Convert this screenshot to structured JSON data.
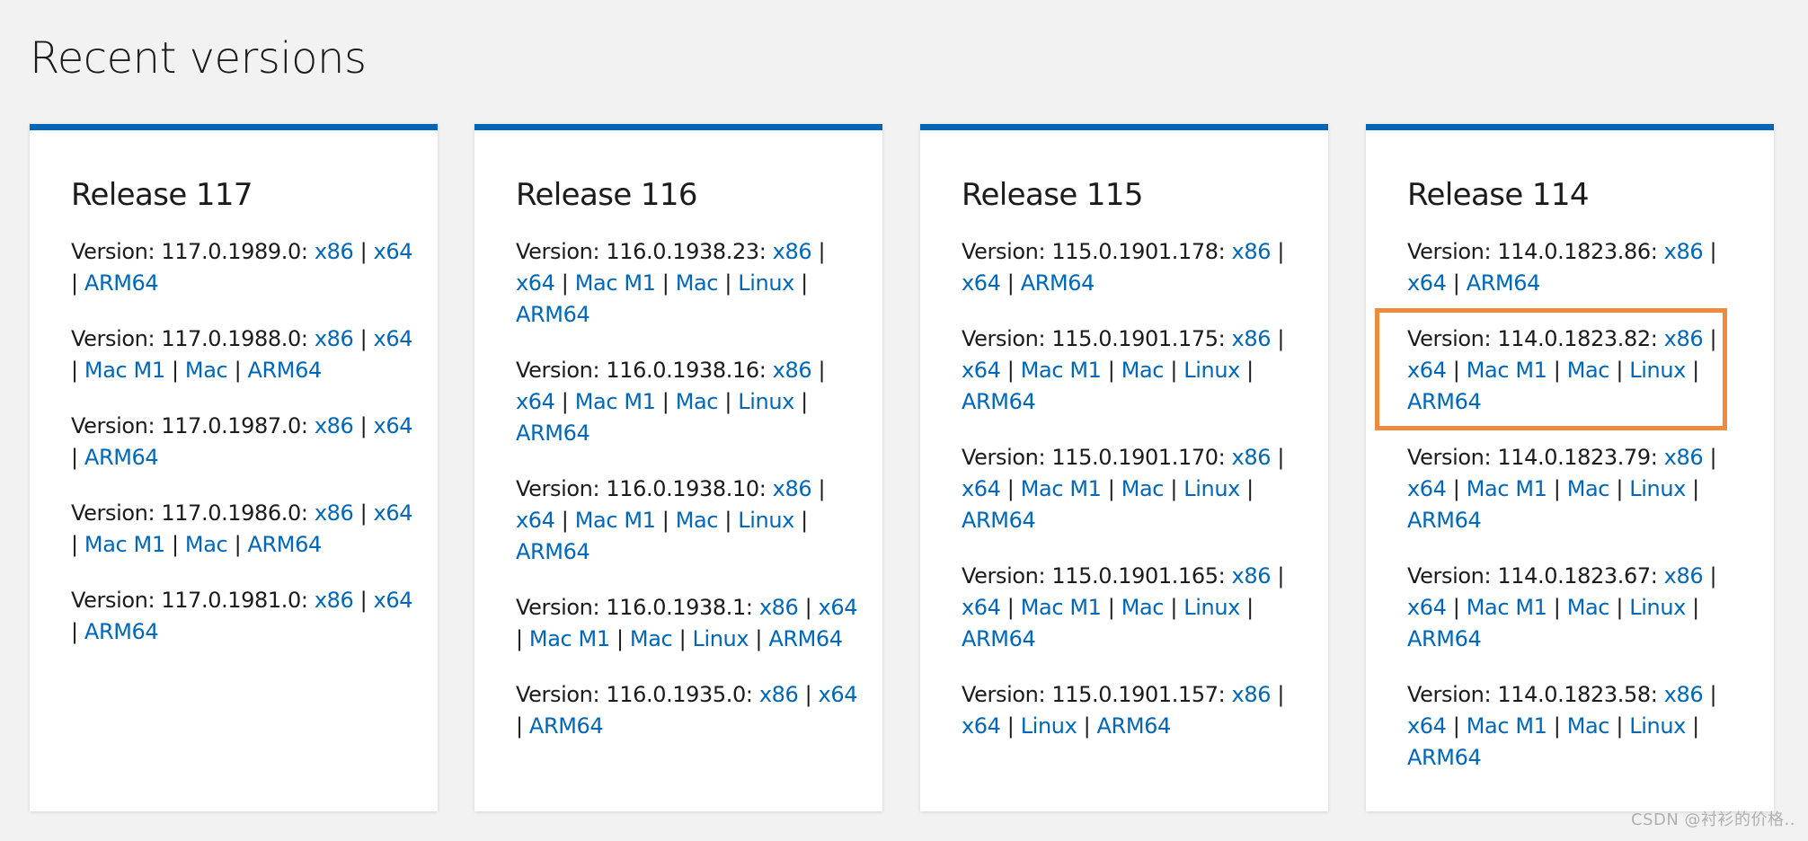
{
  "page": {
    "title": "Recent versions",
    "watermark": "CSDN @衬衫的价格.."
  },
  "colors": {
    "accent": "#0067b8",
    "highlight": "#f08a3c",
    "background": "#f2f2f2"
  },
  "releases": [
    {
      "title": "Release 117",
      "versions": [
        {
          "label": "Version: 117.0.1989.0:",
          "links": [
            "x86",
            "x64",
            "ARM64"
          ]
        },
        {
          "label": "Version: 117.0.1988.0:",
          "links": [
            "x86",
            "x64",
            "Mac M1",
            "Mac",
            "ARM64"
          ]
        },
        {
          "label": "Version: 117.0.1987.0:",
          "links": [
            "x86",
            "x64",
            "ARM64"
          ]
        },
        {
          "label": "Version: 117.0.1986.0:",
          "links": [
            "x86",
            "x64",
            "Mac M1",
            "Mac",
            "ARM64"
          ]
        },
        {
          "label": "Version: 117.0.1981.0:",
          "links": [
            "x86",
            "x64",
            "ARM64"
          ]
        }
      ]
    },
    {
      "title": "Release 116",
      "versions": [
        {
          "label": "Version: 116.0.1938.23:",
          "links": [
            "x86",
            "x64",
            "Mac M1",
            "Mac",
            "Linux",
            "ARM64"
          ]
        },
        {
          "label": "Version: 116.0.1938.16:",
          "links": [
            "x86",
            "x64",
            "Mac M1",
            "Mac",
            "Linux",
            "ARM64"
          ]
        },
        {
          "label": "Version: 116.0.1938.10:",
          "links": [
            "x86",
            "x64",
            "Mac M1",
            "Mac",
            "Linux",
            "ARM64"
          ]
        },
        {
          "label": "Version: 116.0.1938.1:",
          "links": [
            "x86",
            "x64",
            "Mac M1",
            "Mac",
            "Linux",
            "ARM64"
          ]
        },
        {
          "label": "Version: 116.0.1935.0:",
          "links": [
            "x86",
            "x64",
            "ARM64"
          ]
        }
      ]
    },
    {
      "title": "Release 115",
      "versions": [
        {
          "label": "Version: 115.0.1901.178:",
          "links": [
            "x86",
            "x64",
            "ARM64"
          ]
        },
        {
          "label": "Version: 115.0.1901.175:",
          "links": [
            "x86",
            "x64",
            "Mac M1",
            "Mac",
            "Linux",
            "ARM64"
          ]
        },
        {
          "label": "Version: 115.0.1901.170:",
          "links": [
            "x86",
            "x64",
            "Mac M1",
            "Mac",
            "Linux",
            "ARM64"
          ]
        },
        {
          "label": "Version: 115.0.1901.165:",
          "links": [
            "x86",
            "x64",
            "Mac M1",
            "Mac",
            "Linux",
            "ARM64"
          ]
        },
        {
          "label": "Version: 115.0.1901.157:",
          "links": [
            "x86",
            "x64",
            "Linux",
            "ARM64"
          ]
        }
      ]
    },
    {
      "title": "Release 114",
      "versions": [
        {
          "label": "Version: 114.0.1823.86:",
          "links": [
            "x86",
            "x64",
            "ARM64"
          ]
        },
        {
          "label": "Version: 114.0.1823.82:",
          "links": [
            "x86",
            "x64",
            "Mac M1",
            "Mac",
            "Linux",
            "ARM64"
          ]
        },
        {
          "label": "Version: 114.0.1823.79:",
          "links": [
            "x86",
            "x64",
            "Mac M1",
            "Mac",
            "Linux",
            "ARM64"
          ]
        },
        {
          "label": "Version: 114.0.1823.67:",
          "links": [
            "x86",
            "x64",
            "Mac M1",
            "Mac",
            "Linux",
            "ARM64"
          ]
        },
        {
          "label": "Version: 114.0.1823.58:",
          "links": [
            "x86",
            "x64",
            "Mac M1",
            "Mac",
            "Linux",
            "ARM64"
          ]
        }
      ]
    }
  ]
}
